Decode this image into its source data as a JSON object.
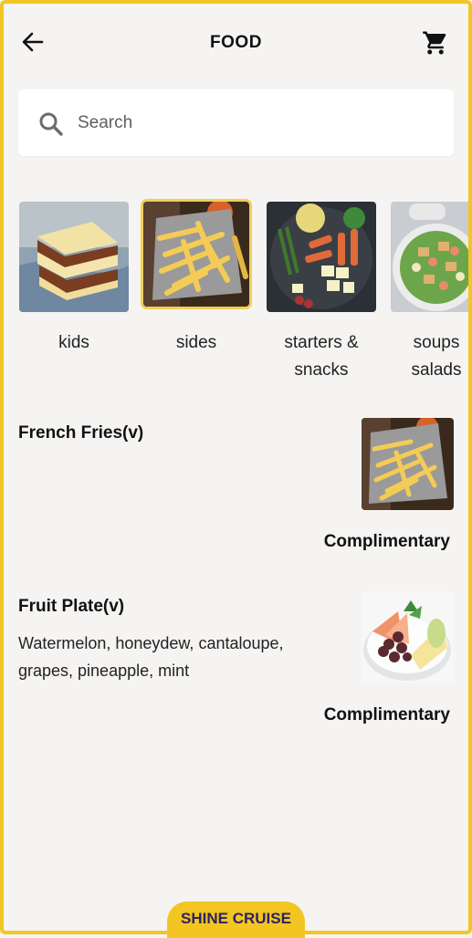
{
  "header": {
    "title": "FOOD",
    "back_icon": "arrow-left-icon",
    "cart_icon": "cart-icon"
  },
  "search": {
    "placeholder": "Search",
    "icon": "search-icon"
  },
  "categories": [
    {
      "label": "kids",
      "selected": false
    },
    {
      "label": "sides",
      "selected": true
    },
    {
      "label": "starters &\nsnacks",
      "selected": false
    },
    {
      "label": "soups\nsalads",
      "selected": false
    }
  ],
  "items": [
    {
      "name": "French Fries(v)",
      "description": "",
      "price": "Complimentary"
    },
    {
      "name": "Fruit Plate(v)",
      "description": "Watermelon, honeydew, cantaloupe, grapes, pineapple, mint",
      "price": "Complimentary"
    }
  ],
  "brand": {
    "label": "SHINE CRUISE",
    "color": "#f2c523"
  },
  "colors": {
    "accent": "#f2c523",
    "selected_border": "#f2cf55",
    "background": "#f5f4f2"
  }
}
